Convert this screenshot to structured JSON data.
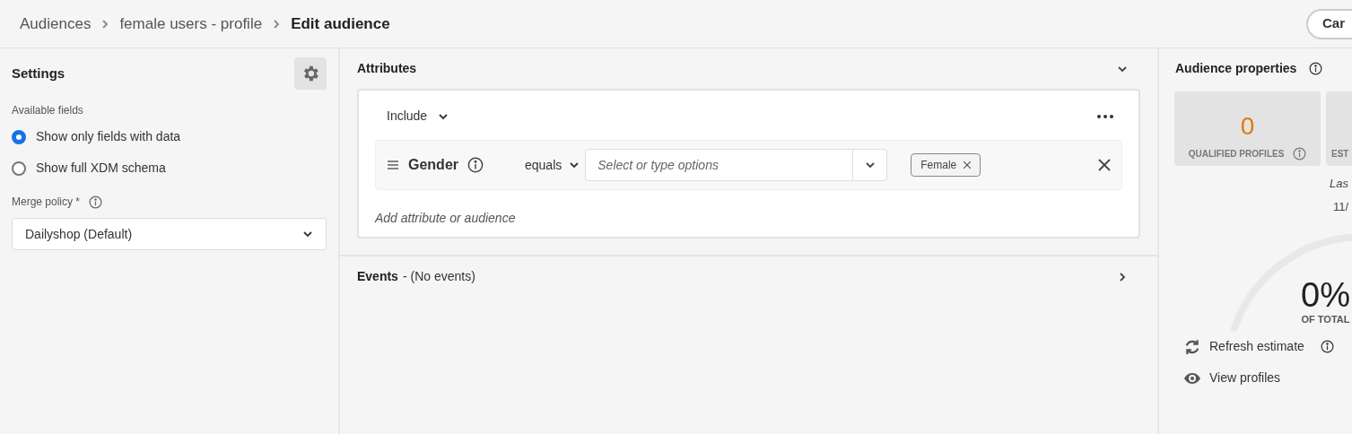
{
  "breadcrumbs": [
    {
      "label": "Audiences",
      "current": false
    },
    {
      "label": "female users - profile",
      "current": false
    },
    {
      "label": "Edit audience",
      "current": true
    }
  ],
  "header_button": "Car",
  "settings": {
    "title": "Settings",
    "available_fields_label": "Available fields",
    "options": [
      {
        "label": "Show only fields with data",
        "selected": true
      },
      {
        "label": "Show full XDM schema",
        "selected": false
      }
    ],
    "merge_policy_label": "Merge policy *",
    "merge_policy_value": "Dailyshop (Default)"
  },
  "attributes": {
    "title": "Attributes",
    "expanded": true,
    "include": "Include",
    "condition": {
      "field": "Gender",
      "operator": "equals",
      "placeholder": "Select or type options",
      "tags": [
        "Female"
      ]
    },
    "add_link": "Add attribute or audience"
  },
  "events": {
    "title": "Events",
    "note": "- (No events)",
    "expanded": false
  },
  "audience_properties": {
    "title": "Audience properties",
    "cards": [
      {
        "value": "0",
        "label": "QUALIFIED PROFILES"
      },
      {
        "label": "EST"
      }
    ],
    "last_label": "Las",
    "last_value": "11/",
    "percent": "0%",
    "percent_label": "OF TOTAL",
    "actions": [
      {
        "kind": "refresh",
        "label": "Refresh estimate"
      },
      {
        "kind": "view",
        "label": "View profiles"
      }
    ]
  }
}
